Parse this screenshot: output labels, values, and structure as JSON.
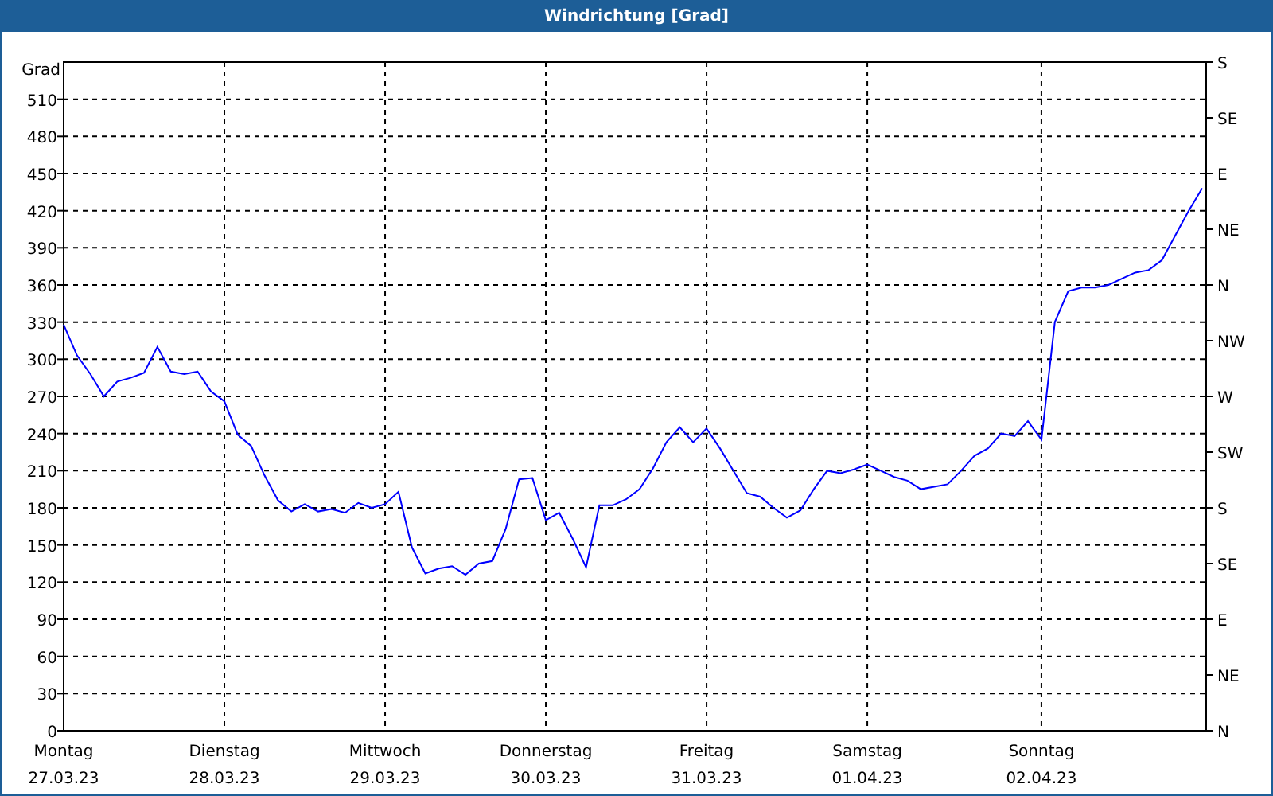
{
  "window": {
    "title": "Windrichtung [Grad]"
  },
  "chart": {
    "right_axis_labels": [
      "S",
      "SE",
      "E",
      "NE",
      "N",
      "NW",
      "W",
      "SW",
      "S",
      "SE",
      "E",
      "NE",
      "N"
    ],
    "day_dates": [
      "27.03.23",
      "28.03.23",
      "29.03.23",
      "30.03.23",
      "31.03.23",
      "01.04.23",
      "02.04.23"
    ],
    "chart_data": {
      "type": "line",
      "ylabel": "Grad",
      "grid": true,
      "ylim": [
        0,
        540
      ],
      "yticks": [
        {
          "value": 0,
          "label": "0"
        },
        {
          "value": 30,
          "label": "30"
        },
        {
          "value": 60,
          "label": "60"
        },
        {
          "value": 90,
          "label": "90"
        },
        {
          "value": 120,
          "label": "120"
        },
        {
          "value": 150,
          "label": "150"
        },
        {
          "value": 180,
          "label": "180"
        },
        {
          "value": 210,
          "label": "210"
        },
        {
          "value": 240,
          "label": "240"
        },
        {
          "value": 270,
          "label": "270"
        },
        {
          "value": 300,
          "label": "300"
        },
        {
          "value": 330,
          "label": "330"
        },
        {
          "value": 360,
          "label": "360"
        },
        {
          "value": 390,
          "label": "390"
        },
        {
          "value": 420,
          "label": "420"
        },
        {
          "value": 450,
          "label": "450"
        },
        {
          "value": 480,
          "label": "480"
        },
        {
          "value": 510,
          "label": "510"
        }
      ],
      "categories": [
        "Montag",
        null,
        null,
        null,
        null,
        null,
        null,
        null,
        null,
        null,
        null,
        null,
        "Dienstag",
        null,
        null,
        null,
        null,
        null,
        null,
        null,
        null,
        null,
        null,
        null,
        "Mittwoch",
        null,
        null,
        null,
        null,
        null,
        null,
        null,
        null,
        null,
        null,
        null,
        "Donnerstag",
        null,
        null,
        null,
        null,
        null,
        null,
        null,
        null,
        null,
        null,
        null,
        "Freitag",
        null,
        null,
        null,
        null,
        null,
        null,
        null,
        null,
        null,
        null,
        null,
        "Samstag",
        null,
        null,
        null,
        null,
        null,
        null,
        null,
        null,
        null,
        null,
        null,
        null,
        "Sonntag",
        null,
        null,
        null,
        null,
        null,
        null,
        null,
        null,
        null,
        null,
        null,
        null
      ],
      "series": [
        {
          "color": "#0000ff",
          "values": [
            328,
            303,
            288,
            270,
            282,
            285,
            289,
            310,
            290,
            288,
            290,
            274,
            266,
            239,
            230,
            206,
            186,
            177,
            183,
            177,
            179,
            176,
            184,
            180,
            183,
            193,
            148,
            127,
            131,
            133,
            126,
            135,
            137,
            163,
            203,
            204,
            170,
            176,
            155,
            132,
            182,
            182,
            187,
            195,
            212,
            233,
            245,
            233,
            244,
            228,
            210,
            192,
            189,
            180,
            172,
            178,
            195,
            210,
            208,
            211,
            215,
            210,
            205,
            202,
            195,
            197,
            199,
            210,
            222,
            228,
            240,
            238,
            250,
            235,
            330,
            355,
            358,
            358,
            360,
            365,
            370,
            372,
            380,
            400,
            420,
            438
          ]
        }
      ]
    }
  }
}
